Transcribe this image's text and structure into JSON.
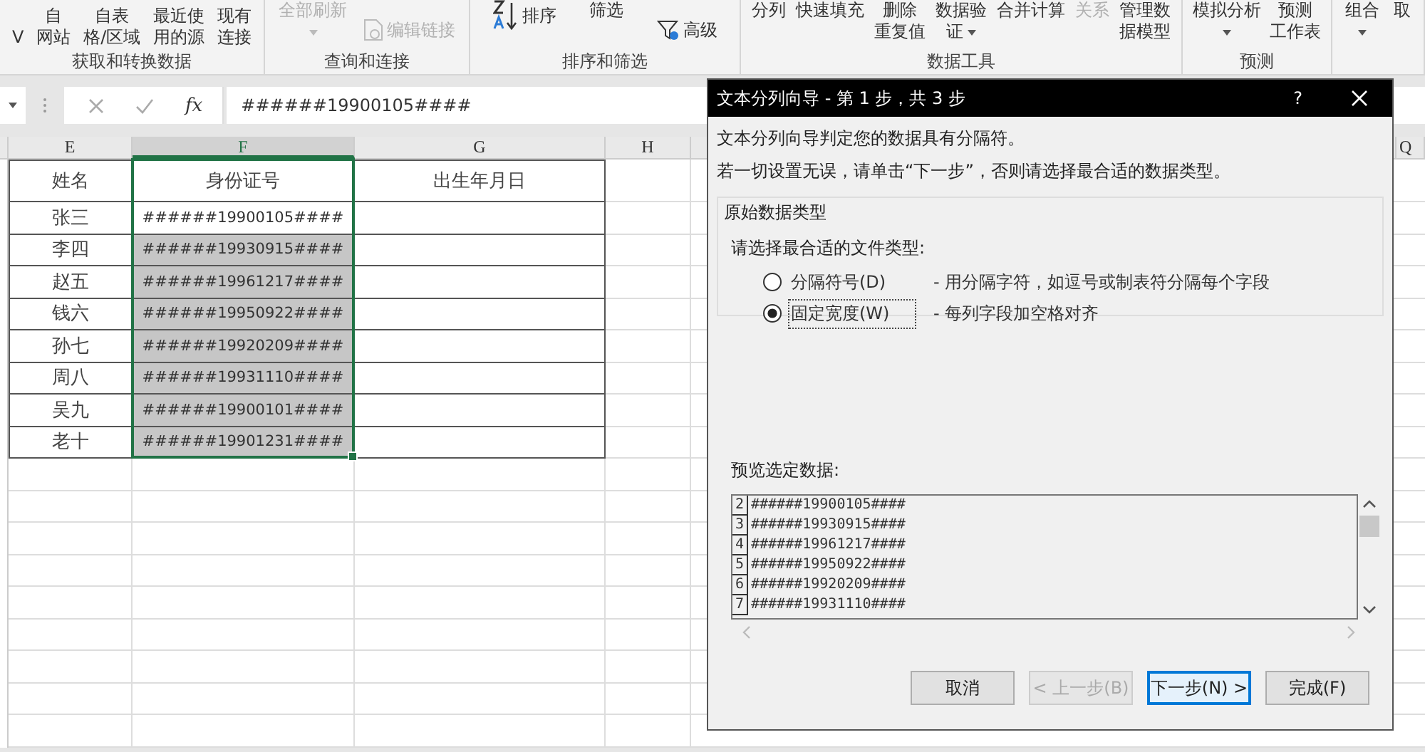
{
  "ribbon": {
    "groups": [
      {
        "label": "获取和转换数据",
        "items": [
          {
            "kind": "large",
            "lines": [
              "V"
            ],
            "disabled": false
          },
          {
            "kind": "large",
            "lines": [
              "自",
              "网站"
            ],
            "disabled": false
          },
          {
            "kind": "large",
            "lines": [
              "自表",
              "格/区域"
            ],
            "disabled": false
          },
          {
            "kind": "large",
            "lines": [
              "最近使",
              "用的源"
            ],
            "disabled": false
          },
          {
            "kind": "large",
            "lines": [
              "现有",
              "连接"
            ],
            "disabled": false
          }
        ]
      },
      {
        "label": "查询和连接",
        "items": [
          {
            "kind": "large",
            "lines": [
              "全部刷新"
            ],
            "caret": true,
            "disabled": true
          },
          {
            "kind": "link",
            "lines": [
              "编辑链接"
            ],
            "disabled": true
          }
        ]
      },
      {
        "label": "排序和筛选",
        "items": [
          {
            "kind": "sort",
            "lines": [
              "排序"
            ],
            "disabled": false
          },
          {
            "kind": "large",
            "lines": [
              "筛选"
            ],
            "disabled": false
          },
          {
            "kind": "advanced",
            "lines": [
              "高级"
            ],
            "disabled": false
          }
        ]
      },
      {
        "label": "数据工具",
        "items": [
          {
            "kind": "large",
            "lines": [
              "分列"
            ],
            "disabled": false
          },
          {
            "kind": "large",
            "lines": [
              "快速填充"
            ],
            "disabled": false
          },
          {
            "kind": "large",
            "lines": [
              "删除",
              "重复值"
            ],
            "disabled": false
          },
          {
            "kind": "large",
            "lines": [
              "数据验",
              "证"
            ],
            "caret": true,
            "disabled": false
          },
          {
            "kind": "large",
            "lines": [
              "合并计算"
            ],
            "disabled": false
          },
          {
            "kind": "large",
            "lines": [
              "关系"
            ],
            "disabled": true
          },
          {
            "kind": "large",
            "lines": [
              "管理数",
              "据模型"
            ],
            "disabled": false
          }
        ]
      },
      {
        "label": "预测",
        "items": [
          {
            "kind": "large",
            "lines": [
              "模拟分析"
            ],
            "caret": true,
            "disabled": false
          },
          {
            "kind": "large",
            "lines": [
              "预测",
              "工作表"
            ],
            "disabled": false
          }
        ]
      },
      {
        "items": [
          {
            "kind": "large",
            "lines": [
              "组合"
            ],
            "caret": true,
            "disabled": false
          },
          {
            "kind": "large",
            "lines": [
              "取"
            ],
            "disabled": false
          }
        ]
      }
    ]
  },
  "formula_bar": {
    "fx": "fx",
    "value": "######19900105####"
  },
  "sheet": {
    "columns": [
      {
        "label": "E",
        "selected": false
      },
      {
        "label": "F",
        "selected": true
      },
      {
        "label": "G",
        "selected": false
      },
      {
        "label": "H",
        "selected": false
      },
      {
        "label": "Q",
        "selected": false
      }
    ],
    "header": [
      "姓名",
      "身份证号",
      "出生年月日"
    ],
    "rows": [
      {
        "name": "张三",
        "id": "######19900105####",
        "highlighted": false
      },
      {
        "name": "李四",
        "id": "######19930915####",
        "highlighted": true
      },
      {
        "name": "赵五",
        "id": "######19961217####",
        "highlighted": true
      },
      {
        "name": "钱六",
        "id": "######19950922####",
        "highlighted": true
      },
      {
        "name": "孙七",
        "id": "######19920209####",
        "highlighted": true
      },
      {
        "name": "周八",
        "id": "######19931110####",
        "highlighted": true
      },
      {
        "name": "吴九",
        "id": "######19900101####",
        "highlighted": true
      },
      {
        "name": "老十",
        "id": "######19901231####",
        "highlighted": true
      }
    ]
  },
  "dialog": {
    "title": "文本分列向导 - 第 1 步，共 3 步",
    "help": "?",
    "intro": [
      "文本分列向导判定您的数据具有分隔符。",
      "若一切设置无误，请单击“下一步”，否则请选择最合适的数据类型。"
    ],
    "group_title": "原始数据类型",
    "prompt": "请选择最合适的文件类型:",
    "options": [
      {
        "label": "分隔符号(D)",
        "description": "- 用分隔字符，如逗号或制表符分隔每个字段",
        "selected": false
      },
      {
        "label": "固定宽度(W)",
        "description": "- 每列字段加空格对齐",
        "selected": true
      }
    ],
    "preview_label": "预览选定数据:",
    "preview": [
      {
        "number": "2",
        "text": "######19900105####"
      },
      {
        "number": "3",
        "text": "######19930915####"
      },
      {
        "number": "4",
        "text": "######19961217####"
      },
      {
        "number": "5",
        "text": "######19950922####"
      },
      {
        "number": "6",
        "text": "######19920209####"
      },
      {
        "number": "7",
        "text": "######19931110####"
      }
    ],
    "buttons": [
      {
        "label": "取消",
        "disabled": false,
        "default": false
      },
      {
        "label": "< 上一步(B)",
        "disabled": true,
        "default": false
      },
      {
        "label": "下一步(N) >",
        "disabled": false,
        "default": true
      },
      {
        "label": "完成(F)",
        "disabled": false,
        "default": false
      }
    ]
  }
}
